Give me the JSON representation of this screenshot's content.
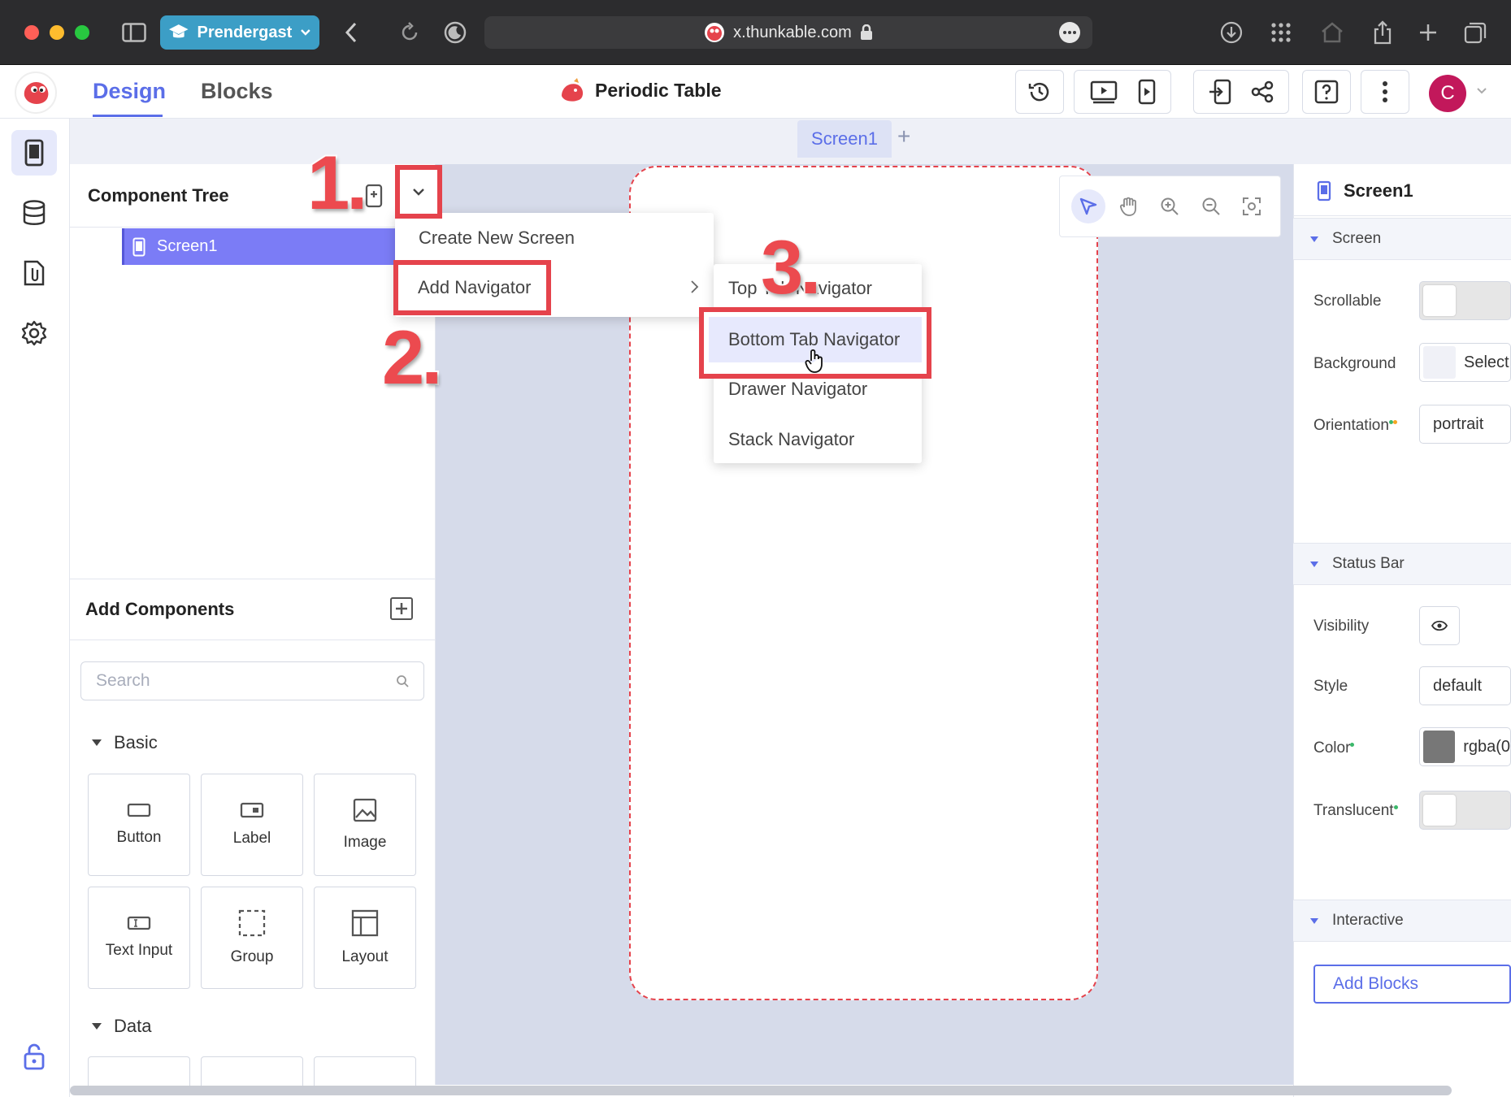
{
  "browser": {
    "profile": "Prendergast",
    "url": "x.thunkable.com"
  },
  "header": {
    "tabs": {
      "design": "Design",
      "blocks": "Blocks"
    },
    "project_title": "Periodic Table",
    "avatar_letter": "C"
  },
  "screen_tabs": {
    "active": "Screen1",
    "add": "+"
  },
  "component_tree": {
    "title": "Component Tree",
    "items": [
      "Screen1"
    ],
    "menu": {
      "create_new_screen": "Create New Screen",
      "add_navigator": "Add Navigator"
    },
    "navigator_submenu": [
      "Top Tab Navigator",
      "Bottom Tab Navigator",
      "Drawer Navigator",
      "Stack Navigator"
    ]
  },
  "annotations": {
    "step1": "1.",
    "step2": "2.",
    "step3": "3."
  },
  "add_components": {
    "title": "Add Components",
    "search_placeholder": "Search",
    "sections": {
      "basic": "Basic",
      "data": "Data"
    },
    "basic_items": [
      "Button",
      "Label",
      "Image",
      "Text Input",
      "Group",
      "Layout"
    ]
  },
  "properties": {
    "title": "Screen1",
    "sections": {
      "screen": "Screen",
      "status_bar": "Status Bar",
      "interactive": "Interactive"
    },
    "scrollable_label": "Scrollable",
    "background_label": "Background",
    "background_value": "Select",
    "orientation_label": "Orientation",
    "orientation_value": "portrait",
    "visibility_label": "Visibility",
    "style_label": "Style",
    "style_value": "default",
    "color_label": "Color",
    "color_value": "rgba(0",
    "translucent_label": "Translucent",
    "add_blocks": "Add Blocks"
  },
  "colors": {
    "accent": "#5b6ee8",
    "highlight_red": "#e5434c",
    "selected_tree": "#7b7cf6",
    "browser_pill": "#3c9ec6"
  },
  "icons": [
    "sidebar-icon",
    "back-icon",
    "reload-icon",
    "moon-icon",
    "lock-icon",
    "more-icon",
    "download-icon",
    "grid-icon",
    "home-icon",
    "share-icon",
    "plus-icon",
    "tabs-icon",
    "history-icon",
    "preview-icon",
    "phone-preview-icon",
    "export-icon",
    "share-network-icon",
    "help-icon",
    "kebab-icon",
    "chevron-down-icon",
    "phone-icon",
    "database-icon",
    "file-icon",
    "gear-icon",
    "unlock-icon",
    "pointer-icon",
    "hand-icon",
    "zoom-in-icon",
    "zoom-out-icon",
    "fit-icon",
    "eye-icon"
  ]
}
